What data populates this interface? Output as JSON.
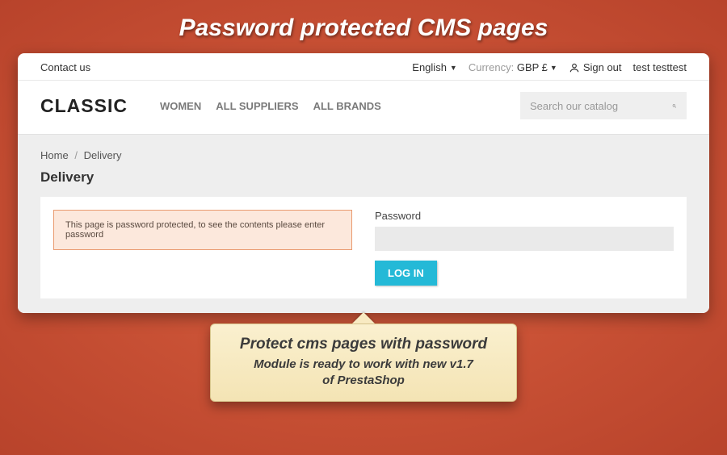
{
  "hero": {
    "title": "Password protected CMS pages"
  },
  "topbar": {
    "contact": "Contact us",
    "language": "English",
    "currency_label": "Currency:",
    "currency_value": "GBP £",
    "signout": "Sign out",
    "username": "test testtest"
  },
  "header": {
    "logo": "CLASSIC",
    "nav": {
      "women": "WOMEN",
      "suppliers": "ALL SUPPLIERS",
      "brands": "ALL BRANDS"
    },
    "search_placeholder": "Search our catalog"
  },
  "breadcrumb": {
    "home": "Home",
    "current": "Delivery"
  },
  "page": {
    "title": "Delivery"
  },
  "alert": {
    "message": "This page is password protected, to see the contents please enter password"
  },
  "form": {
    "password_label": "Password",
    "login_button": "LOG IN"
  },
  "callout": {
    "title": "Protect cms pages with password",
    "line1": "Module is ready to work with new v1.7",
    "line2": "of PrestaShop"
  }
}
